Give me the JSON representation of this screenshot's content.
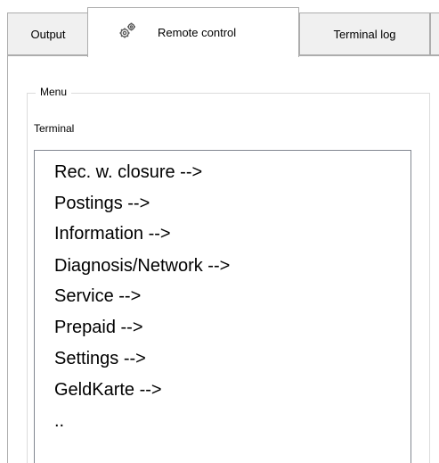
{
  "tabs": [
    {
      "label": "Output"
    },
    {
      "label": "Remote control",
      "icon": "gears-icon"
    },
    {
      "label": "Terminal log"
    }
  ],
  "group": {
    "title": "Menu"
  },
  "terminal": {
    "label": "Terminal",
    "items": [
      "Rec. w. closure  -->",
      "Postings  -->",
      "Information  -->",
      "Diagnosis/Network  -->",
      "Service  -->",
      "Prepaid  -->",
      "Settings  -->",
      "GeldKarte  -->",
      ".."
    ]
  }
}
